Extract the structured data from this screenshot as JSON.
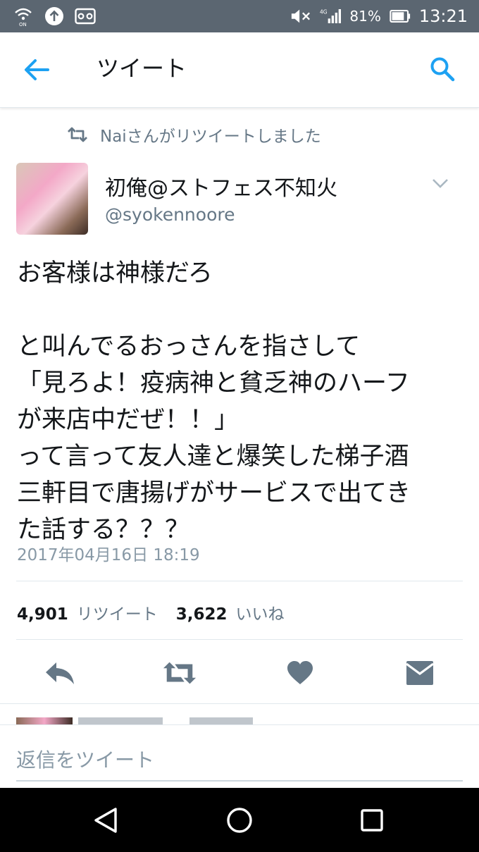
{
  "status_bar": {
    "time": "13:21",
    "battery_percent": "81%",
    "network": "4G",
    "icons": [
      "wifi-calling-icon",
      "upload-icon",
      "voicemail-icon",
      "mute-icon",
      "signal-icon",
      "battery-icon"
    ]
  },
  "app_bar": {
    "title": "ツイート",
    "back_icon": "arrow-left-icon",
    "search_icon": "search-icon"
  },
  "retweet_context": {
    "text": "Naiさんがリツイートしました",
    "icon": "retweet-icon"
  },
  "tweet": {
    "author_name": "初俺@ストフェス不知火",
    "author_handle": "@syokennoore",
    "text": "お客様は神様だろ\n\nと叫んでるおっさんを指さして\n「見ろよ！疫病神と貧乏神のハーフ\nが来店中だぜ！！」\nって言って友人達と爆笑した梯子酒\n三軒目で唐揚げがサービスで出てき\nた話する？？？",
    "timestamp": "2017年04月16日 18:19",
    "retweet_count": "4,901",
    "retweet_label": "リツイート",
    "like_count": "3,622",
    "like_label": "いいね"
  },
  "actions": [
    "reply-icon",
    "retweet-icon",
    "like-icon",
    "direct-message-icon"
  ],
  "reply_box": {
    "placeholder": "返信をツイート"
  },
  "colors": {
    "status_bar": "#5b6671",
    "accent": "#1da1f2",
    "secondary_text": "#657786",
    "action_icon": "#657786",
    "nav_bar": "#000000"
  }
}
